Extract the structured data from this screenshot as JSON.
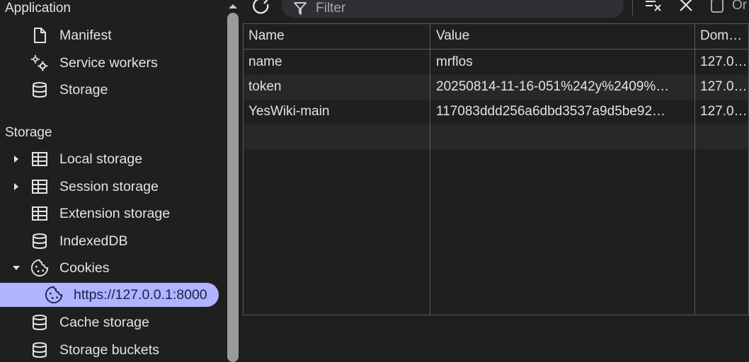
{
  "sidebar": {
    "application_header": "Application",
    "application_items": [
      {
        "label": "Manifest",
        "icon": "document-icon"
      },
      {
        "label": "Service workers",
        "icon": "gears-icon"
      },
      {
        "label": "Storage",
        "icon": "database-icon"
      }
    ],
    "storage_header": "Storage",
    "storage_items": [
      {
        "label": "Local storage",
        "icon": "table-icon",
        "expandable": true
      },
      {
        "label": "Session storage",
        "icon": "table-icon",
        "expandable": true
      },
      {
        "label": "Extension storage",
        "icon": "table-icon"
      },
      {
        "label": "IndexedDB",
        "icon": "database-icon"
      },
      {
        "label": "Cookies",
        "icon": "cookie-icon",
        "expanded": true
      },
      {
        "label": "https://127.0.0.1:8000",
        "icon": "cookie-icon",
        "selected": true
      },
      {
        "label": "Cache storage",
        "icon": "database-icon"
      },
      {
        "label": "Storage buckets",
        "icon": "database-icon"
      }
    ],
    "selected_color": "#b0b4ff"
  },
  "toolbar": {
    "filter_placeholder": "Filter",
    "only_label": "Or"
  },
  "table": {
    "columns": [
      "Name",
      "Value",
      "Dom…"
    ],
    "rows": [
      {
        "name": "name",
        "value": "mrflos",
        "domain": "127.0…"
      },
      {
        "name": "token",
        "value": "20250814-11-16-051%242y%2409%…",
        "domain": "127.0…"
      },
      {
        "name": "YesWiki-main",
        "value": "117083ddd256a6dbd3537a9d5be92…",
        "domain": "127.0…"
      }
    ]
  }
}
